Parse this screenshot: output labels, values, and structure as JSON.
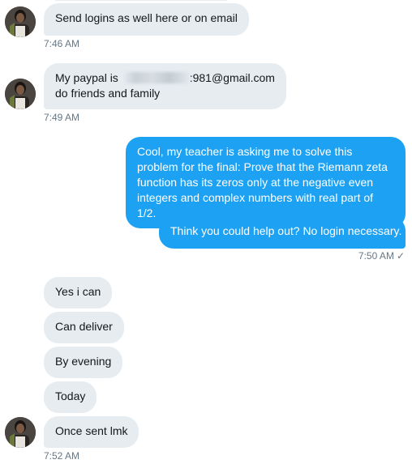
{
  "messages": {
    "m1": {
      "text": "Send logins as well here or on email",
      "time": "7:46 AM"
    },
    "m2": {
      "line1_prefix": "My paypal is ",
      "line1_suffix": ":981@gmail.com",
      "line2": "do friends and family",
      "time": "7:49 AM"
    },
    "m3": {
      "text": "Cool, my teacher is asking me to solve this problem for the final: Prove that the Riemann zeta function has its zeros only at the negative even integers and complex numbers with real part of 1/2."
    },
    "m4": {
      "text": "Think you could help out? No login necessary.",
      "time": "7:50 AM",
      "status_icon": "check-icon"
    },
    "m5": {
      "text": "Yes i can"
    },
    "m6": {
      "text": "Can deliver"
    },
    "m7": {
      "text": "By evening"
    },
    "m8": {
      "text": "Today"
    },
    "m9": {
      "text": "Once sent lmk",
      "time": "7:52 AM"
    }
  },
  "colors": {
    "incoming_bubble": "#e6ecf0",
    "outgoing_bubble": "#1da1f2",
    "timestamp": "#657786"
  }
}
